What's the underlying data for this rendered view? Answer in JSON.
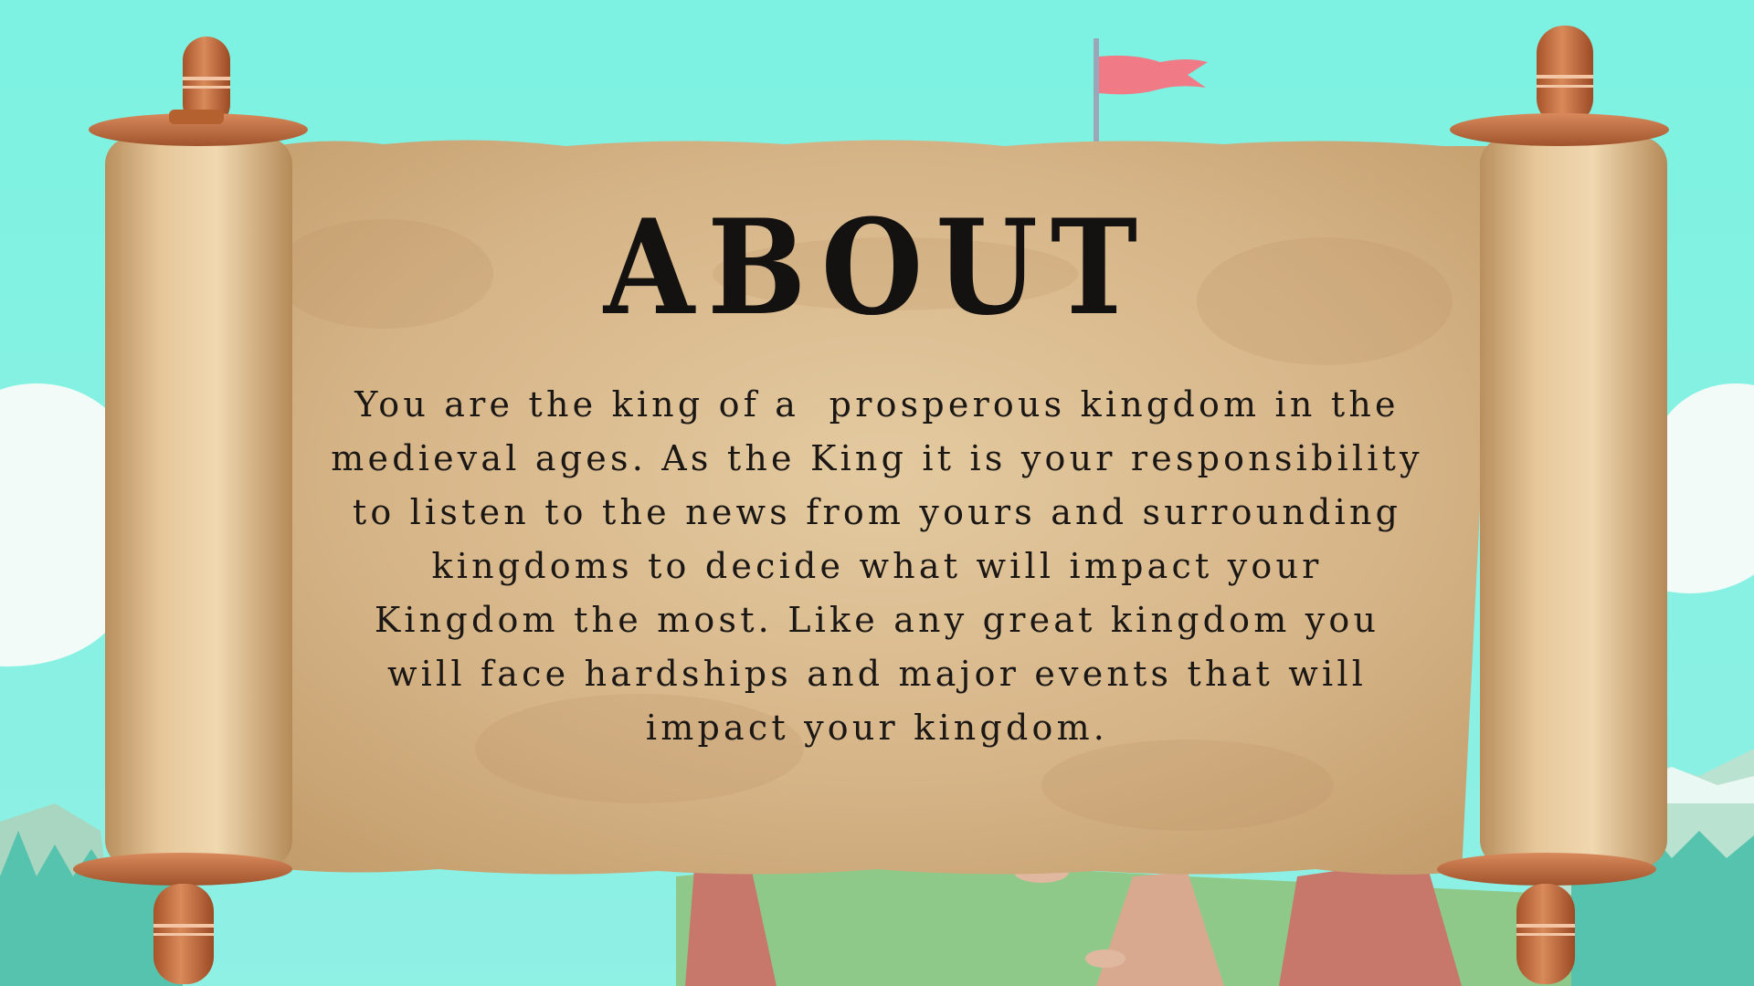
{
  "screen": {
    "title": "ABOUT",
    "body_lines": [
      "You are the king of a  prosperous kingdom in the",
      "medieval ages. As the King it is your responsibility",
      "to listen to the news from yours and surrounding",
      "kingdoms to decide what will impact your",
      "Kingdom the most. Like any great kingdom you",
      "will face hardships and major events that will",
      "impact your kingdom."
    ]
  },
  "colors": {
    "sky": "#7ff0e0",
    "parchment": "#d8b98c",
    "scroll_rod": "#c9703f",
    "flag": "#f07a86",
    "text": "#141210"
  },
  "icons": {
    "flag": "flag-icon",
    "scroll": "parchment-scroll"
  }
}
